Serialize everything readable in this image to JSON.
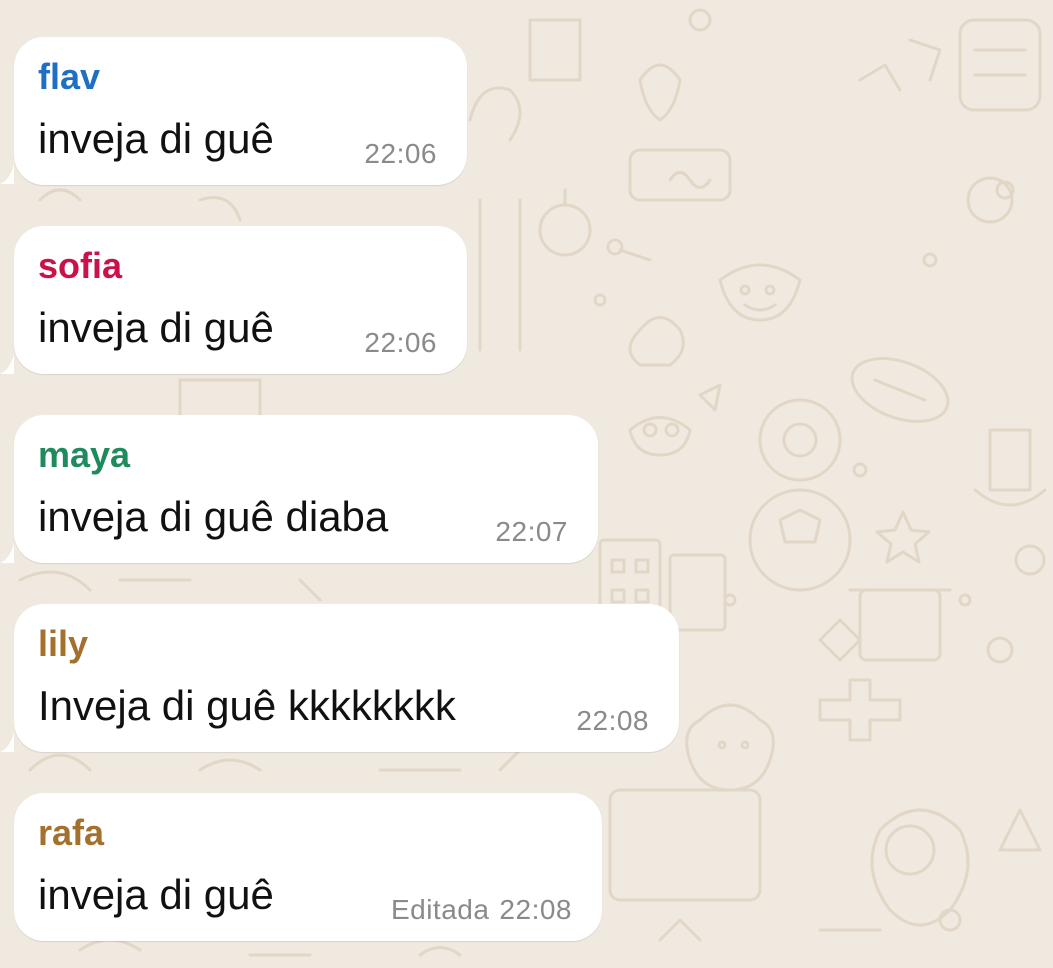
{
  "chat": {
    "messages": [
      {
        "sender": "flav",
        "sender_color": "#1f6fc5",
        "text": "inveja di guê",
        "time": "22:06",
        "edited": ""
      },
      {
        "sender": "sofia",
        "sender_color": "#c9124a",
        "text": "inveja di guê",
        "time": "22:06",
        "edited": ""
      },
      {
        "sender": "maya",
        "sender_color": "#1f8a5b",
        "text": "inveja di guê diaba",
        "time": "22:07",
        "edited": ""
      },
      {
        "sender": "lily",
        "sender_color": "#a3702d",
        "text": "Inveja di guê kkkkkkkk",
        "time": "22:08",
        "edited": ""
      },
      {
        "sender": "rafa",
        "sender_color": "#a3702d",
        "text": "inveja di guê",
        "time": "22:08",
        "edited": "Editada"
      }
    ]
  },
  "theme": {
    "wallpaper_color": "#efe9e0",
    "doodle_color": "#e2d8c8",
    "bubble_color": "#ffffff",
    "meta_color": "#8a8a8a"
  }
}
